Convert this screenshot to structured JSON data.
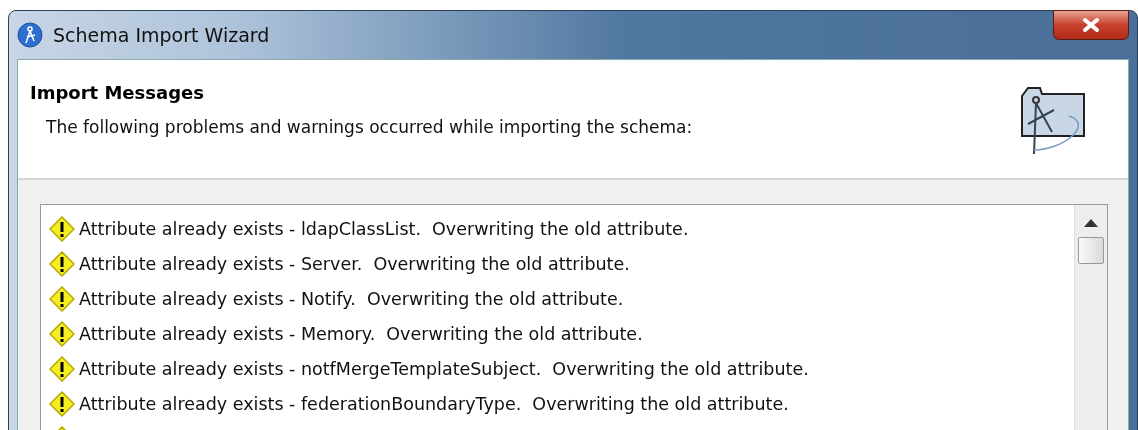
{
  "window": {
    "title": "Schema Import Wizard"
  },
  "header": {
    "title": "Import Messages",
    "description": "The following problems and warnings occurred while importing the schema:"
  },
  "messages": [
    {
      "kind": "warning",
      "text": "Attribute already exists - ldapClassList.  Overwriting the old attribute."
    },
    {
      "kind": "warning",
      "text": "Attribute already exists - Server.  Overwriting the old attribute."
    },
    {
      "kind": "warning",
      "text": "Attribute already exists - Notify.  Overwriting the old attribute."
    },
    {
      "kind": "warning",
      "text": "Attribute already exists - Memory.  Overwriting the old attribute."
    },
    {
      "kind": "warning",
      "text": "Attribute already exists - notfMergeTemplateSubject.  Overwriting the old attribute."
    },
    {
      "kind": "warning",
      "text": "Attribute already exists - federationBoundaryType.  Overwriting the old attribute."
    },
    {
      "kind": "warning"
    }
  ]
}
